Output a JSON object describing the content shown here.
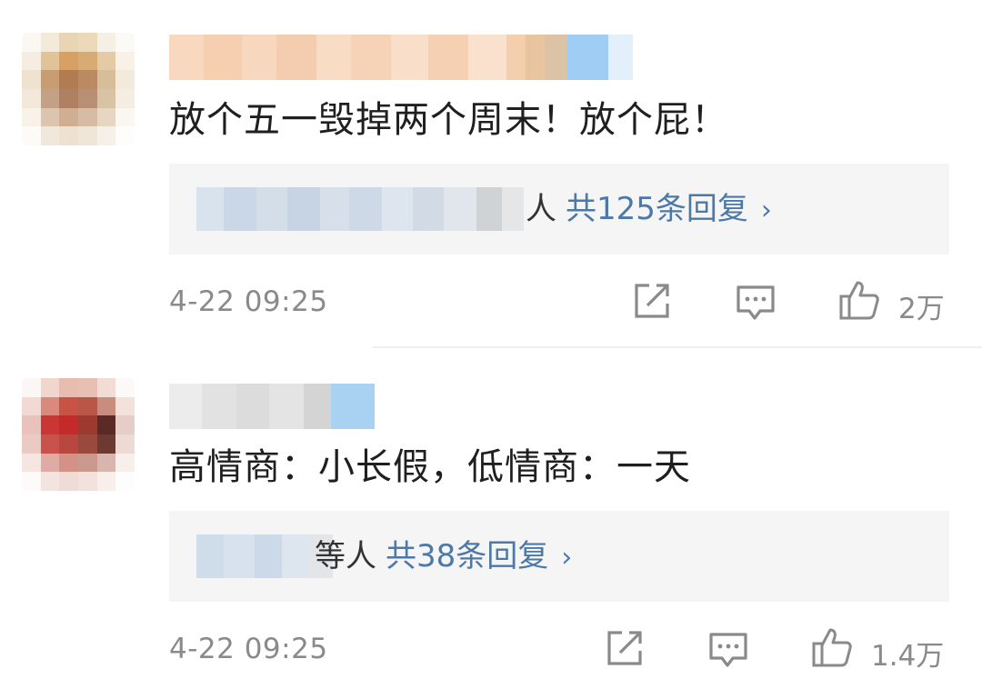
{
  "comments": [
    {
      "text": "放个五一毁掉两个周末！放个屁！",
      "reply_suffix": "人",
      "reply_count": "共125条回复",
      "chevron": "›",
      "time": "4-22 09:25",
      "likes": "2万"
    },
    {
      "text": "高情商：小长假，低情商：一天",
      "reply_suffix": "等人",
      "reply_count": "共38条回复",
      "chevron": "›",
      "time": "4-22 09:25",
      "likes": "1.4万"
    }
  ],
  "icons": {
    "share": "share-icon",
    "comment": "comment-icon",
    "like": "thumbs-up-icon"
  },
  "colors": {
    "reply_link": "#4d79a8",
    "meta_gray": "#8a8a8a",
    "reply_bg": "#f5f5f5"
  }
}
